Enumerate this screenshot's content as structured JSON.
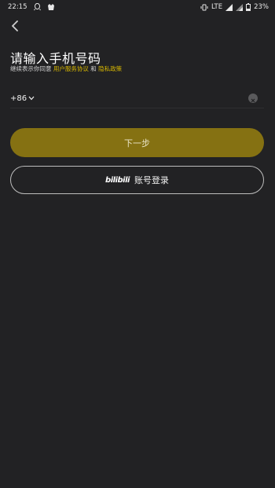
{
  "status_bar": {
    "time": "22:15",
    "network": "LTE",
    "battery": "23%"
  },
  "header": {
    "title": "请输入手机号码",
    "agreement_prefix": "继续表示你同意 ",
    "user_agreement": "用户服务协议",
    "agreement_and": " 和 ",
    "privacy_policy": "隐私政策"
  },
  "phone": {
    "country_code": "+86",
    "value": "",
    "placeholder": ""
  },
  "buttons": {
    "next_label": "下一步",
    "account_login_logo": "bilibili",
    "account_login_label": "账号登录"
  },
  "colors": {
    "background": "#222224",
    "accent": "#d6b600",
    "next_button": "#857112"
  }
}
